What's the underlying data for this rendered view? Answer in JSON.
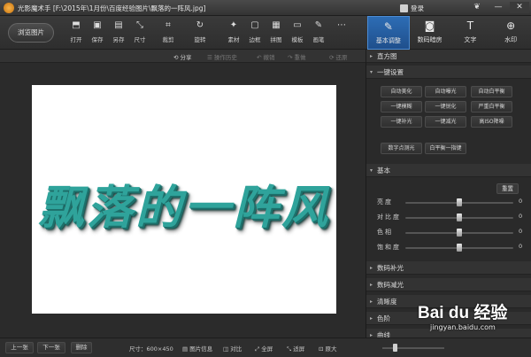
{
  "window": {
    "title": "光影魔术手 [F:\\2015年\\1月份\\百度经验图片\\飘落的一阵风.jpg]",
    "login_label": "登录",
    "controls": [
      "❦",
      "—",
      "✕"
    ]
  },
  "toolbar": {
    "browse_label": "浏览图片",
    "tools": [
      {
        "label": "打开",
        "icon": "open-icon",
        "glyph": "⬒"
      },
      {
        "label": "保存",
        "icon": "save-icon",
        "glyph": "▣"
      },
      {
        "label": "另存",
        "icon": "save-as-icon",
        "glyph": "▤"
      },
      {
        "label": "尺寸",
        "icon": "resize-icon",
        "glyph": "⤡"
      },
      {
        "label": "裁剪",
        "icon": "crop-icon",
        "glyph": "⌗"
      },
      {
        "label": "旋转",
        "icon": "rotate-icon",
        "glyph": "↻"
      },
      {
        "label": "素材",
        "icon": "material-icon",
        "glyph": "✦"
      },
      {
        "label": "边框",
        "icon": "border-icon",
        "glyph": "▢"
      },
      {
        "label": "拼图",
        "icon": "collage-icon",
        "glyph": "▦"
      },
      {
        "label": "模板",
        "icon": "template-icon",
        "glyph": "▭"
      },
      {
        "label": "画笔",
        "icon": "brush-icon",
        "glyph": "✎"
      },
      {
        "label": "",
        "icon": "more-icon",
        "glyph": "⋯"
      }
    ]
  },
  "panel_tabs": [
    {
      "label": "基本调整",
      "glyph": "✎",
      "icon": "basic-adjust-icon",
      "active": true
    },
    {
      "label": "数码暗房",
      "glyph": "◙",
      "icon": "darkroom-icon",
      "active": false
    },
    {
      "label": "文字",
      "glyph": "T",
      "icon": "text-icon",
      "active": false
    },
    {
      "label": "水印",
      "glyph": "⊕",
      "icon": "watermark-icon",
      "active": false
    }
  ],
  "subbar": {
    "share": "分享",
    "history": "操作历史",
    "undo": "撤销",
    "redo": "重做",
    "restore": "还原"
  },
  "canvas": {
    "text": "飘落的一阵风"
  },
  "right_panel": {
    "histogram": "直方图",
    "one_click": "一键设置",
    "one_click_buttons": [
      [
        "自动美化",
        "自动曝光",
        "自动白平衡"
      ],
      [
        "一键模糊",
        "一键锐化",
        "严重白平衡"
      ],
      [
        "一键补光",
        "一键减光",
        "高ISO降噪"
      ]
    ],
    "extra_buttons": [
      "数字点测光",
      "白平衡一指键"
    ],
    "basic": "基本",
    "reset": "重置",
    "sliders": [
      {
        "label": "亮度",
        "value": "0",
        "level": 0.5
      },
      {
        "label": "对比度",
        "value": "0",
        "level": 0.5
      },
      {
        "label": "色相",
        "value": "0",
        "level": 0.5
      },
      {
        "label": "饱和度",
        "value": "0",
        "level": 0.5
      }
    ],
    "collapsed_sections": [
      "数码补光",
      "数码减光",
      "清晰度",
      "色阶",
      "曲线"
    ]
  },
  "statusbar": {
    "prev": "上一张",
    "next": "下一张",
    "delete": "删除",
    "size_label": "尺寸：600×450",
    "image_info": "图片信息",
    "compare": "对比",
    "fullscreen": "全屏",
    "fit": "适屏",
    "original": "原大",
    "zoom_level": 0.2
  },
  "watermark": {
    "main": "Bai du 经验",
    "sub": "jingyan.baidu.com"
  }
}
